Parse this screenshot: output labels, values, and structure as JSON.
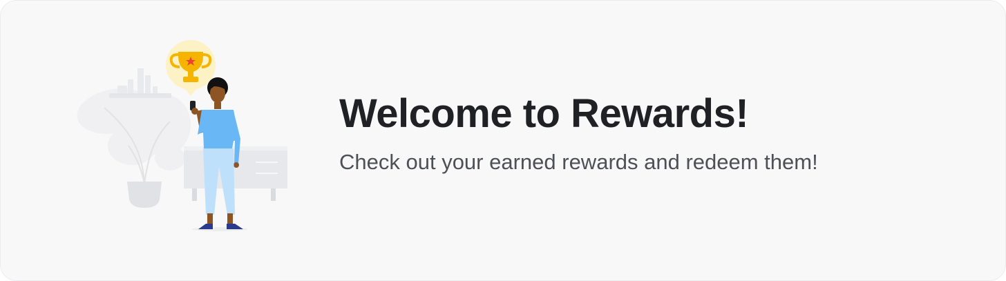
{
  "banner": {
    "title": "Welcome to Rewards!",
    "subtitle": "Check out your earned rewards and redeem them!"
  },
  "illustration": {
    "icon": "trophy-icon",
    "colors": {
      "trophy_gold": "#f4b400",
      "trophy_bubble": "#fdf1c6",
      "shirt": "#6ab7f5",
      "pants": "#bfe0fb",
      "skin": "#8d5524",
      "furniture": "#e6e7ea"
    }
  },
  "colors": {
    "card_background": "#f8f8f9",
    "title_text": "#202124",
    "subtitle_text": "#4d5156"
  }
}
